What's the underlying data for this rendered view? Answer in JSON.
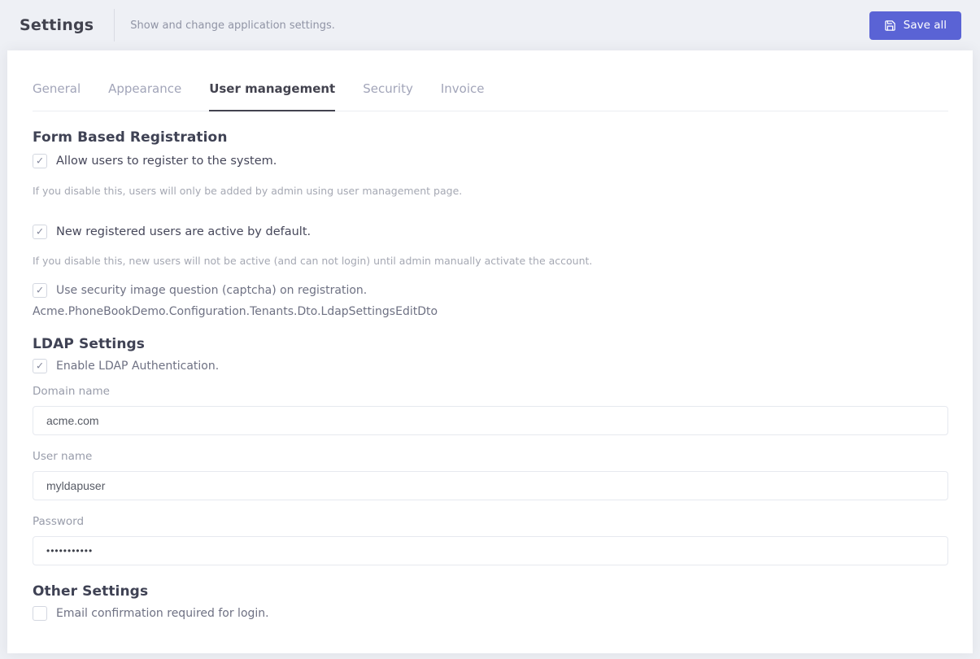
{
  "colors": {
    "accent": "#5a63d5",
    "page_background": "#eef0f5",
    "card_background": "#ffffff",
    "active_tab_underline": "#43434f"
  },
  "header": {
    "title": "Settings",
    "subtitle": "Show and change application settings.",
    "save_button": {
      "label": "Save all",
      "icon": "floppy-disk-icon"
    }
  },
  "tabs": [
    {
      "label": "General",
      "active": false
    },
    {
      "label": "Appearance",
      "active": false
    },
    {
      "label": "User management",
      "active": true
    },
    {
      "label": "Security",
      "active": false
    },
    {
      "label": "Invoice",
      "active": false
    }
  ],
  "sections": {
    "registration": {
      "title": "Form Based Registration",
      "checkbox_allow": {
        "label": "Allow users to register to the system.",
        "checked": true,
        "hint": "If you disable this, users will only be added by admin using user management page."
      },
      "checkbox_active": {
        "label": "New registered users are active by default.",
        "checked": true,
        "hint": "If you disable this, new users will not be active (and can not login) until admin manually activate the account."
      },
      "checkbox_captcha": {
        "label": "Use security image question (captcha) on registration.",
        "checked": true
      },
      "dto_text": "Acme.PhoneBookDemo.Configuration.Tenants.Dto.LdapSettingsEditDto"
    },
    "ldap": {
      "title": "LDAP Settings",
      "checkbox_enable": {
        "label": "Enable LDAP Authentication.",
        "checked": true
      },
      "fields": {
        "domain": {
          "label": "Domain name",
          "value": "acme.com"
        },
        "username": {
          "label": "User name",
          "value": "myldapuser"
        },
        "password": {
          "label": "Password",
          "value_masked": "•••••••••••"
        }
      }
    },
    "other": {
      "title": "Other Settings",
      "checkbox_email": {
        "label": "Email confirmation required for login.",
        "checked": false
      }
    }
  }
}
